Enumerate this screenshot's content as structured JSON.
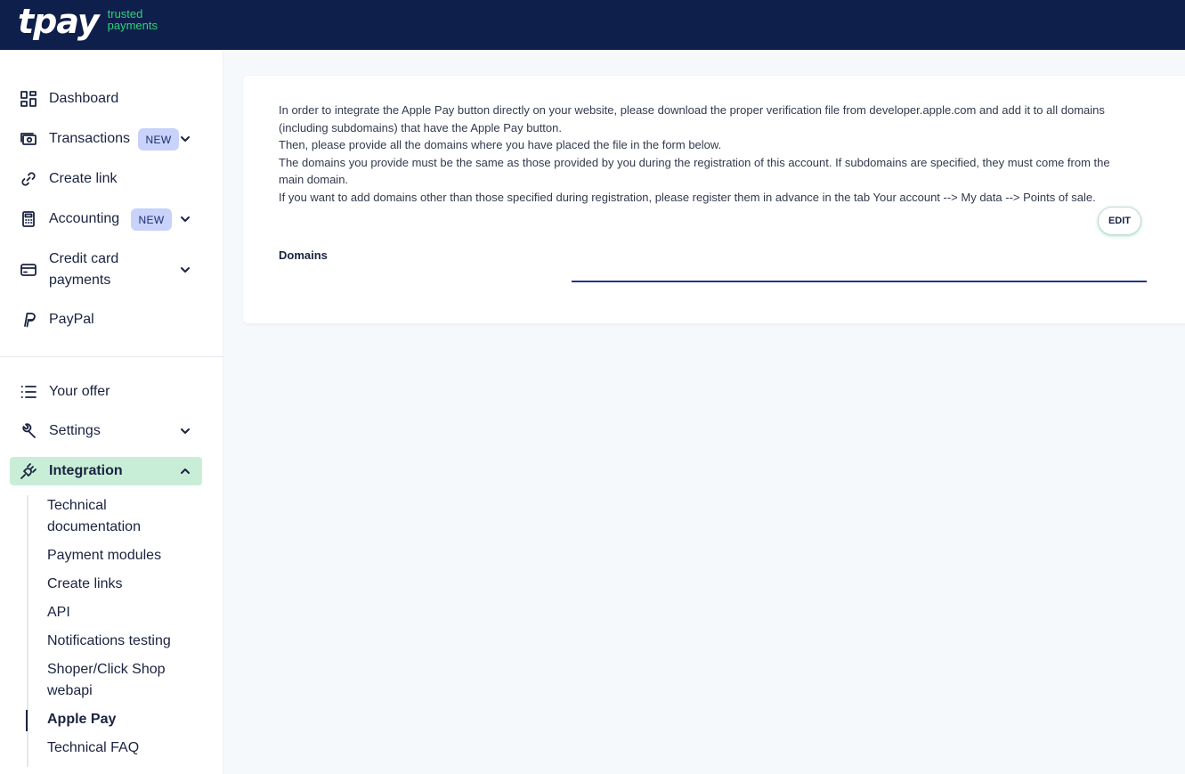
{
  "header": {
    "logo_main": "tpay",
    "logo_tag_line1": "trusted",
    "logo_tag_line2": "payments"
  },
  "sidebar": {
    "items": [
      {
        "label": "Dashboard",
        "icon": "dashboard-icon"
      },
      {
        "label": "Transactions",
        "badge": "NEW",
        "icon": "transactions-icon",
        "expandable": true
      },
      {
        "label": "Create link",
        "icon": "link-icon"
      },
      {
        "label": "Accounting",
        "badge": "NEW",
        "icon": "calculator-icon",
        "expandable": true
      },
      {
        "label_line1": "Credit card",
        "label_line2": "payments",
        "icon": "credit-card-icon",
        "expandable": true
      },
      {
        "label": "PayPal",
        "icon": "paypal-icon"
      },
      {
        "label": "Your offer",
        "icon": "list-icon"
      },
      {
        "label": "Settings",
        "icon": "wrench-icon",
        "expandable": true
      },
      {
        "label": "Integration",
        "icon": "plug-icon",
        "expanded": true,
        "active": true
      }
    ],
    "integration_subitems": [
      {
        "label_line1": "Technical",
        "label_line2": "documentation"
      },
      {
        "label": "Payment modules"
      },
      {
        "label": "Create links"
      },
      {
        "label": "API"
      },
      {
        "label": "Notifications testing"
      },
      {
        "label_line1": "Shoper/Click Shop",
        "label_line2": "webapi"
      },
      {
        "label": "Apple Pay",
        "active": true
      },
      {
        "label": "Technical FAQ"
      }
    ]
  },
  "main": {
    "info_lines": [
      "In order to integrate the Apple Pay button directly on your website, please download the proper verification file from developer.apple.com and add it to all domains (including subdomains) that have the Apple Pay button.",
      "Then, please provide all the domains where you have placed the file in the form below.",
      "The domains you provide must be the same as those provided by you during the registration of this account. If subdomains are specified, they must come from the main domain.",
      "If you want to add domains other than those specified during registration, please register them in advance in the tab Your account --> My data --> Points of sale."
    ],
    "edit_label": "EDIT",
    "domains_label": "Domains",
    "domains_value": ""
  },
  "colors": {
    "topbar": "#0f1f4b",
    "brand_green": "#2dd47a",
    "active_nav": "#c9eed7",
    "badge": "#c8d2fb",
    "field_underline": "#26358f"
  }
}
